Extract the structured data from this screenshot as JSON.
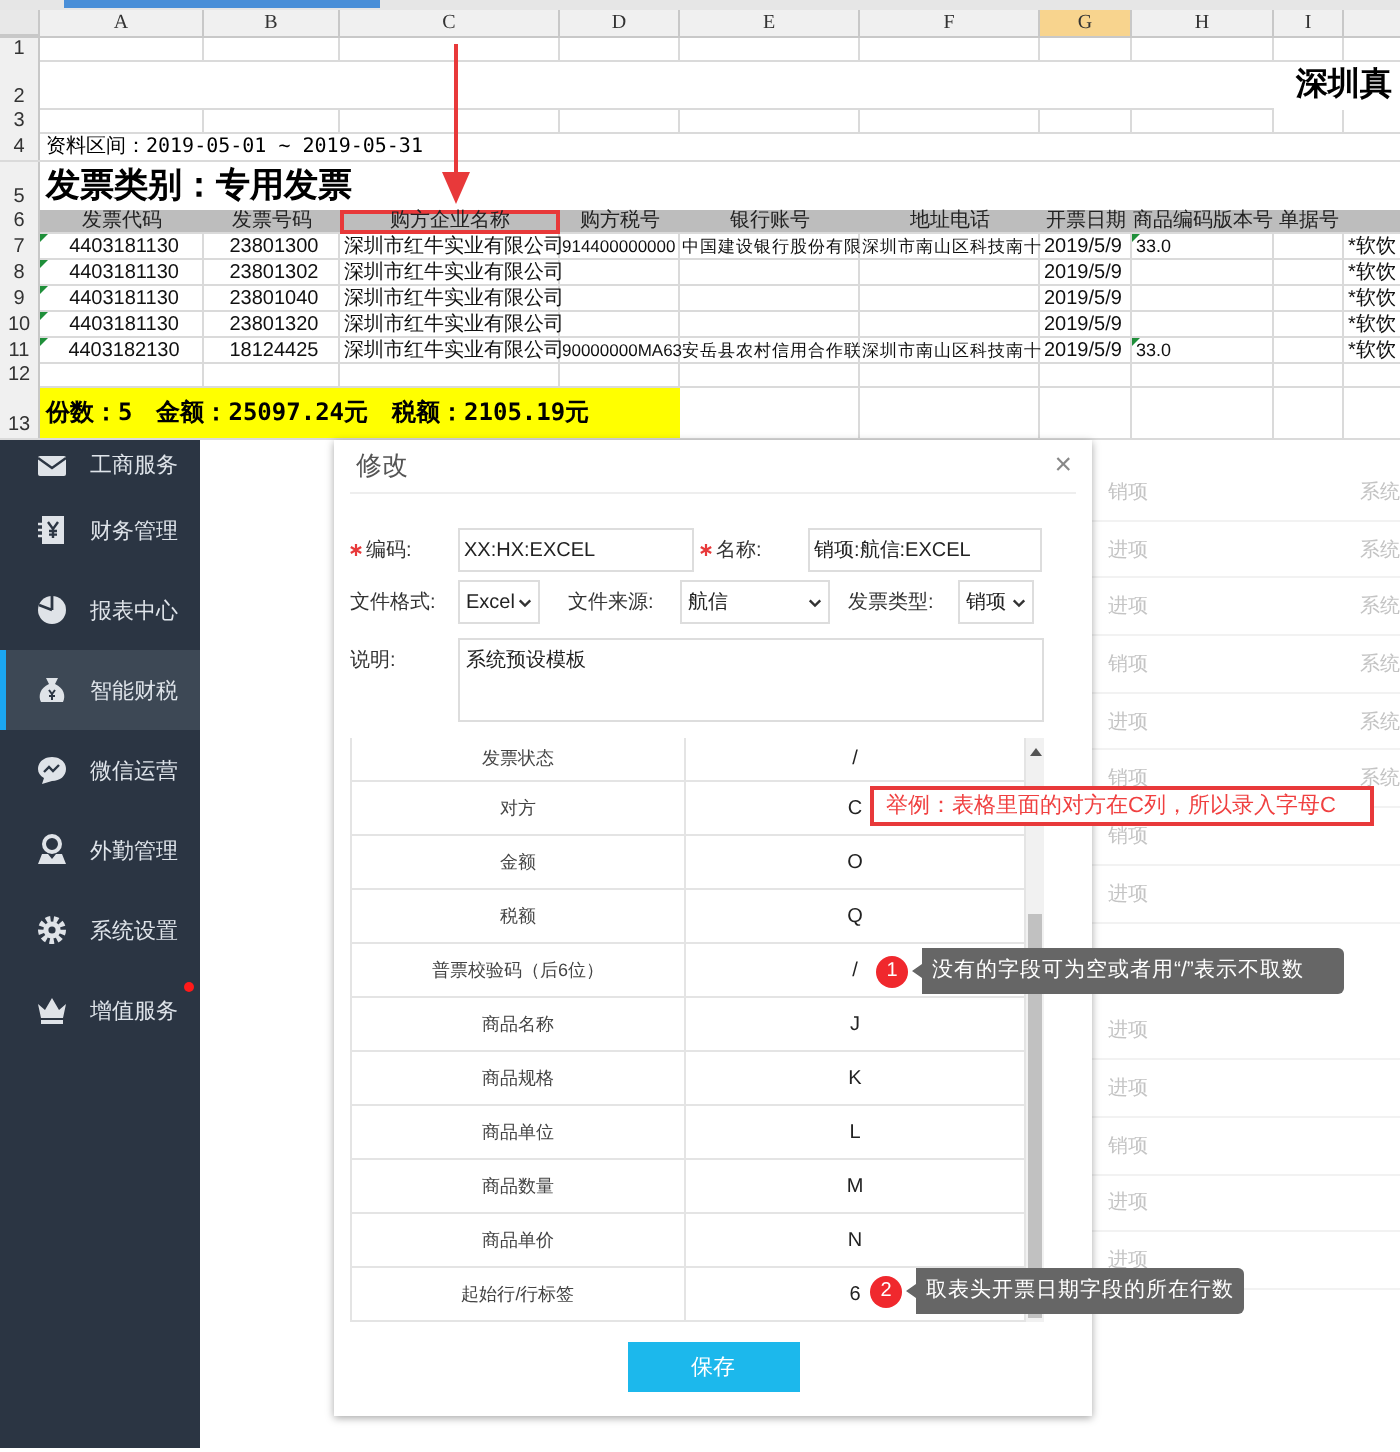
{
  "sheet": {
    "columns": [
      {
        "letter": "A",
        "selected": false
      },
      {
        "letter": "B",
        "selected": false
      },
      {
        "letter": "C",
        "selected": false
      },
      {
        "letter": "D",
        "selected": false
      },
      {
        "letter": "E",
        "selected": false
      },
      {
        "letter": "F",
        "selected": false
      },
      {
        "letter": "G",
        "selected": true
      },
      {
        "letter": "H",
        "selected": false
      },
      {
        "letter": "I",
        "selected": false
      }
    ],
    "rows": [
      {
        "number": "1",
        "kind": "blank"
      },
      {
        "number": "2",
        "kind": "title",
        "cells": {
          "I": {
            "text": "深圳真"
          }
        }
      },
      {
        "number": "3",
        "kind": "blank"
      },
      {
        "number": "4",
        "kind": "period",
        "cells": {
          "A": {
            "text": "资料区间：2019-05-01 ~ 2019-05-31"
          }
        }
      },
      {
        "number": "5",
        "kind": "category",
        "cells": {
          "A": {
            "text": "发票类别：专用发票"
          }
        }
      },
      {
        "number": "6",
        "kind": "header",
        "cells": {
          "A": {
            "text": "发票代码",
            "highlighted": false
          },
          "B": {
            "text": "发票号码",
            "highlighted": false
          },
          "C": {
            "text": "购方企业名称",
            "highlighted": true
          },
          "D": {
            "text": "购方税号",
            "highlighted": false
          },
          "E": {
            "text": "银行账号",
            "highlighted": false
          },
          "F": {
            "text": "地址电话",
            "highlighted": false
          },
          "G": {
            "text": "开票日期",
            "highlighted": false
          },
          "H": {
            "text": "商品编码版本号",
            "highlighted": false
          },
          "I": {
            "text": "单据号",
            "highlighted": false
          }
        }
      },
      {
        "number": "7",
        "kind": "data",
        "cells": {
          "A": {
            "text": "4403181130",
            "flagged": true
          },
          "B": {
            "text": "23801300",
            "flagged": false
          },
          "C": {
            "text": "深圳市红牛实业有限公司",
            "flagged": false
          },
          "D": {
            "text": "914400000000",
            "flagged": false
          },
          "E": {
            "text": "中国建设银行股份有限",
            "flagged": false
          },
          "F": {
            "text": "深圳市南山区科技南十",
            "flagged": false
          },
          "G": {
            "text": "2019/5/9",
            "flagged": false
          },
          "H": {
            "text": "33.0",
            "flagged": true
          },
          "J": {
            "text": "*软饮",
            "flagged": false
          }
        }
      },
      {
        "number": "8",
        "kind": "data",
        "cells": {
          "A": {
            "text": "4403181130",
            "flagged": true
          },
          "B": {
            "text": "23801302",
            "flagged": false
          },
          "C": {
            "text": "深圳市红牛实业有限公司",
            "flagged": false
          },
          "G": {
            "text": "2019/5/9",
            "flagged": false
          },
          "J": {
            "text": "*软饮",
            "flagged": false
          }
        }
      },
      {
        "number": "9",
        "kind": "data",
        "cells": {
          "A": {
            "text": "4403181130",
            "flagged": true
          },
          "B": {
            "text": "23801040",
            "flagged": false
          },
          "C": {
            "text": "深圳市红牛实业有限公司",
            "flagged": false
          },
          "G": {
            "text": "2019/5/9",
            "flagged": false
          },
          "J": {
            "text": "*软饮",
            "flagged": false
          }
        }
      },
      {
        "number": "10",
        "kind": "data",
        "cells": {
          "A": {
            "text": "4403181130",
            "flagged": true
          },
          "B": {
            "text": "23801320",
            "flagged": false
          },
          "C": {
            "text": "深圳市红牛实业有限公司",
            "flagged": false
          },
          "G": {
            "text": "2019/5/9",
            "flagged": false
          },
          "J": {
            "text": "*软饮",
            "flagged": false
          }
        }
      },
      {
        "number": "11",
        "kind": "data",
        "cells": {
          "A": {
            "text": "4403182130",
            "flagged": true
          },
          "B": {
            "text": "18124425",
            "flagged": false
          },
          "C": {
            "text": "深圳市红牛实业有限公司",
            "flagged": false
          },
          "D": {
            "text": "90000000MA63",
            "flagged": false
          },
          "E": {
            "text": "安岳县农村信用合作联",
            "flagged": false
          },
          "F": {
            "text": "深圳市南山区科技南十",
            "flagged": false
          },
          "G": {
            "text": "2019/5/9",
            "flagged": false
          },
          "H": {
            "text": "33.0",
            "flagged": true
          },
          "J": {
            "text": "*软饮",
            "flagged": false
          }
        }
      },
      {
        "number": "12",
        "kind": "blank"
      },
      {
        "number": "13",
        "kind": "summary",
        "cells": {
          "A": {
            "text": "份数：5　金额：25097.24元　税额：2105.19元"
          }
        }
      }
    ]
  },
  "sidebar": {
    "items": [
      {
        "label": "工商服务",
        "selected": false,
        "dot": false
      },
      {
        "label": "财务管理",
        "selected": false,
        "dot": false
      },
      {
        "label": "报表中心",
        "selected": false,
        "dot": false
      },
      {
        "label": "智能财税",
        "selected": true,
        "dot": false
      },
      {
        "label": "微信运营",
        "selected": false,
        "dot": false
      },
      {
        "label": "外勤管理",
        "selected": false,
        "dot": false
      },
      {
        "label": "系统设置",
        "selected": false,
        "dot": false
      },
      {
        "label": "增值服务",
        "selected": false,
        "dot": true
      }
    ]
  },
  "background_list": {
    "rows": [
      {
        "column_1": "销项",
        "column_2": "系统"
      },
      {
        "column_1": "进项",
        "column_2": "系统"
      },
      {
        "column_1": "进项",
        "column_2": "系统"
      },
      {
        "column_1": "销项",
        "column_2": "系统"
      },
      {
        "column_1": "进项",
        "column_2": "系统"
      },
      {
        "column_1": "销项",
        "column_2": "系统"
      },
      {
        "column_1": "销项"
      },
      {
        "column_1": "进项"
      },
      {
        "column_1": "进项"
      },
      {
        "column_1": "进项"
      },
      {
        "column_1": "销项"
      },
      {
        "column_1": "进项"
      },
      {
        "column_1": "进项"
      }
    ]
  },
  "dialog": {
    "title": "修改",
    "close": "×",
    "fields": [
      {
        "label": "编码:",
        "required": true,
        "value": "XX:HX:EXCEL"
      },
      {
        "label": "名称:",
        "required": true,
        "value": "销项:航信:EXCEL"
      }
    ],
    "selects": [
      {
        "label": "文件格式:",
        "value": "Excel"
      },
      {
        "label": "文件来源:",
        "value": "航信"
      },
      {
        "label": "发票类型:",
        "value": "销项"
      }
    ],
    "description": {
      "label": "说明:",
      "value": "系统预设模板"
    },
    "mapping_rows": [
      {
        "field": "发票状态",
        "column": "/"
      },
      {
        "field": "对方",
        "column": "C"
      },
      {
        "field": "金额",
        "column": "O"
      },
      {
        "field": "税额",
        "column": "Q"
      },
      {
        "field": "普票校验码（后6位）",
        "column": "/"
      },
      {
        "field": "商品名称",
        "column": "J"
      },
      {
        "field": "商品规格",
        "column": "K"
      },
      {
        "field": "商品单位",
        "column": "L"
      },
      {
        "field": "商品数量",
        "column": "M"
      },
      {
        "field": "商品单价",
        "column": "N"
      },
      {
        "field": "起始行/行标签",
        "column": "6"
      }
    ],
    "save_button": "保存"
  },
  "annotations": [
    {
      "kind": "boxed_note",
      "text": "举例：表格里面的对方在C列，所以录入字母C"
    },
    {
      "kind": "tooltip",
      "badge": "1",
      "text": "没有的字段可为空或者用“/”表示不取数"
    },
    {
      "kind": "tooltip",
      "badge": "2",
      "text": "取表头开票日期字段的所在行数"
    }
  ]
}
